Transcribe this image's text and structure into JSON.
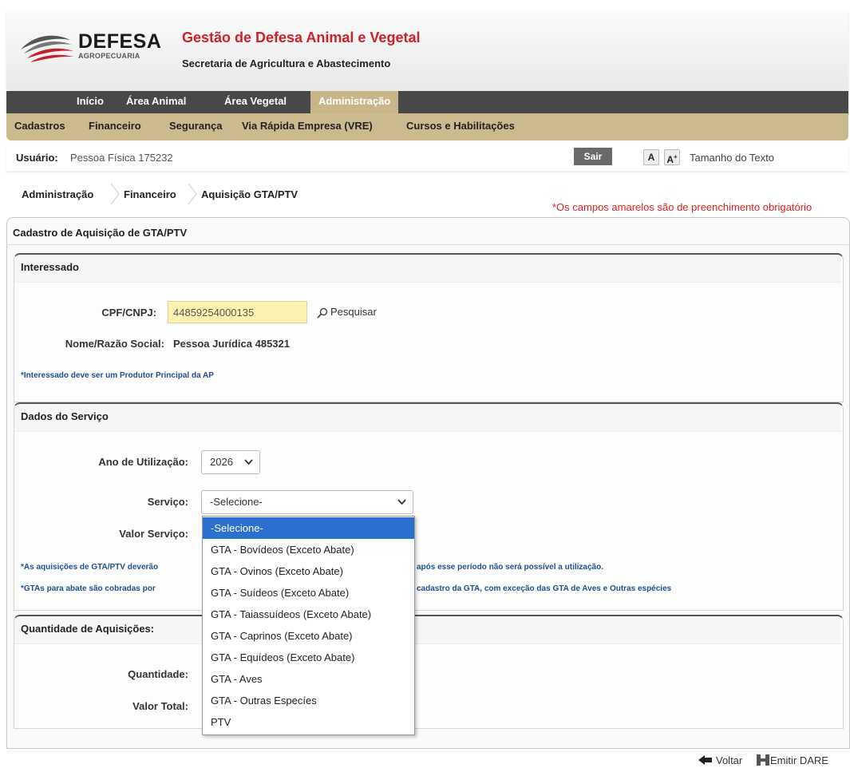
{
  "header": {
    "logo_text": "DEFESA",
    "logo_sub": "AGROPECUARIA",
    "title": "Gestão de Defesa Animal e Vegetal",
    "subtitle": "Secretaria de Agricultura e Abastecimento"
  },
  "topnav": [
    "Início",
    "Área Animal",
    "Área Vegetal",
    "Administração"
  ],
  "subnav": [
    "Cadastros",
    "Financeiro",
    "Segurança",
    "Via Rápida Empresa (VRE)",
    "Cursos e Habilitações"
  ],
  "user": {
    "label": "Usuário:",
    "value": "Pessoa Física 175232",
    "logout": "Sair",
    "font_small": "A",
    "font_large": "A",
    "font_plus": "+",
    "text_size": "Tamanho do Texto"
  },
  "breadcrumb": [
    "Administração",
    "Financeiro",
    "Aquisição GTA/PTV"
  ],
  "required_note": "*Os campos amarelos são de preenchimento obrigatório",
  "page_title": "Cadastro de Aquisição de GTA/PTV",
  "interessado": {
    "title": "Interessado",
    "cpf_label": "CPF/CNPJ:",
    "cpf_value": "44859254000135",
    "search": "Pesquisar",
    "nome_label": "Nome/Razão Social:",
    "nome_value": "Pessoa Jurídica 485321",
    "note": "*Interessado deve ser um Produtor Principal da AP"
  },
  "servico": {
    "title": "Dados do Serviço",
    "ano_label": "Ano de Utilização:",
    "ano_value": "2026",
    "servico_label": "Serviço:",
    "servico_value": "-Selecione-",
    "valor_label": "Valor Serviço:",
    "note1_a": "*As aquisições de GTA/PTV deverão",
    "note1_b": "após esse período não será possível a utilização.",
    "note2_a": "*GTAs para abate são cobradas por",
    "note2_b": "cadastro da GTA, com exceção das GTA de Aves e Outras espécies",
    "options": [
      "-Selecione-",
      "GTA - Bovídeos (Exceto Abate)",
      "GTA - Ovinos (Exceto Abate)",
      "GTA - Suídeos (Exceto Abate)",
      "GTA - Taiassuídeos (Exceto Abate)",
      "GTA - Caprinos (Exceto Abate)",
      "GTA - Equídeos (Exceto Abate)",
      "GTA - Aves",
      "GTA - Outras Especíes",
      "PTV"
    ]
  },
  "quantidade": {
    "title": "Quantidade de Aquisições:",
    "qtd_label": "Quantidade:",
    "total_label": "Valor Total:"
  },
  "footer": {
    "back": "Voltar",
    "emit": "Emitir DARE"
  },
  "colors": {
    "brand_red": "#d0202a",
    "nav_dark": "#484848",
    "nav_tan": "#cbba8e",
    "required_yellow": "#fdf3b1",
    "selected_blue": "#2b6fcf"
  }
}
